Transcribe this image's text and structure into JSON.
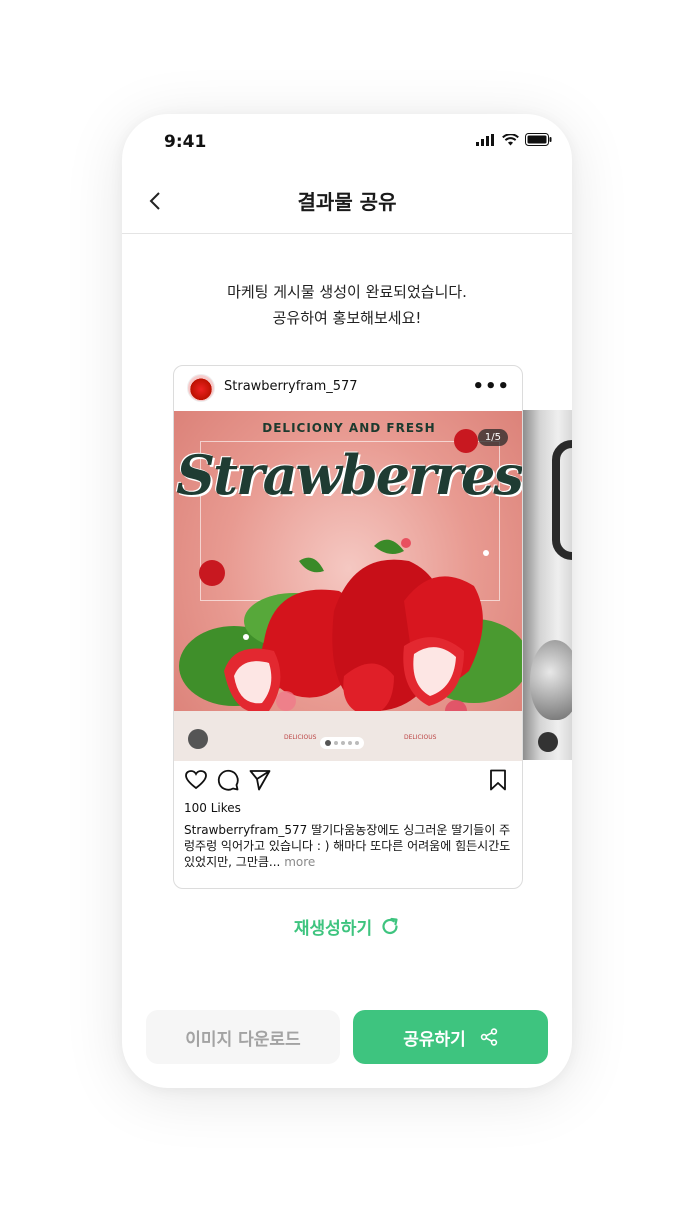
{
  "status_bar": {
    "time": "9:41"
  },
  "nav": {
    "title": "결과물 공유"
  },
  "message": {
    "line1": "마케팅 게시물 생성이 완료되었습니다.",
    "line2": "공유하여 홍보해보세요!"
  },
  "post": {
    "username": "Strawberryfram_577",
    "more_menu": "•••",
    "image": {
      "tagline": "DELICIONY AND FRESH",
      "title": "Strawberres",
      "counter": "1/5",
      "slides": 5,
      "active_slide": 1
    },
    "likes": "100 Likes",
    "caption": "Strawberryfram_577 딸기다움농장에도 싱그러운 딸기들이 주렁주렁 익어가고 있습니다 : ) 해마다 또다른 어려움에 힘든시간도 있었지만, 그만큼...",
    "caption_more": "more"
  },
  "regenerate": {
    "label": "재생성하기"
  },
  "buttons": {
    "download": "이미지 다운로드",
    "share": "공유하기"
  },
  "colors": {
    "accent": "#3ec47f",
    "disabled_text": "#a3a3a3",
    "disabled_bg": "#f6f6f6"
  }
}
